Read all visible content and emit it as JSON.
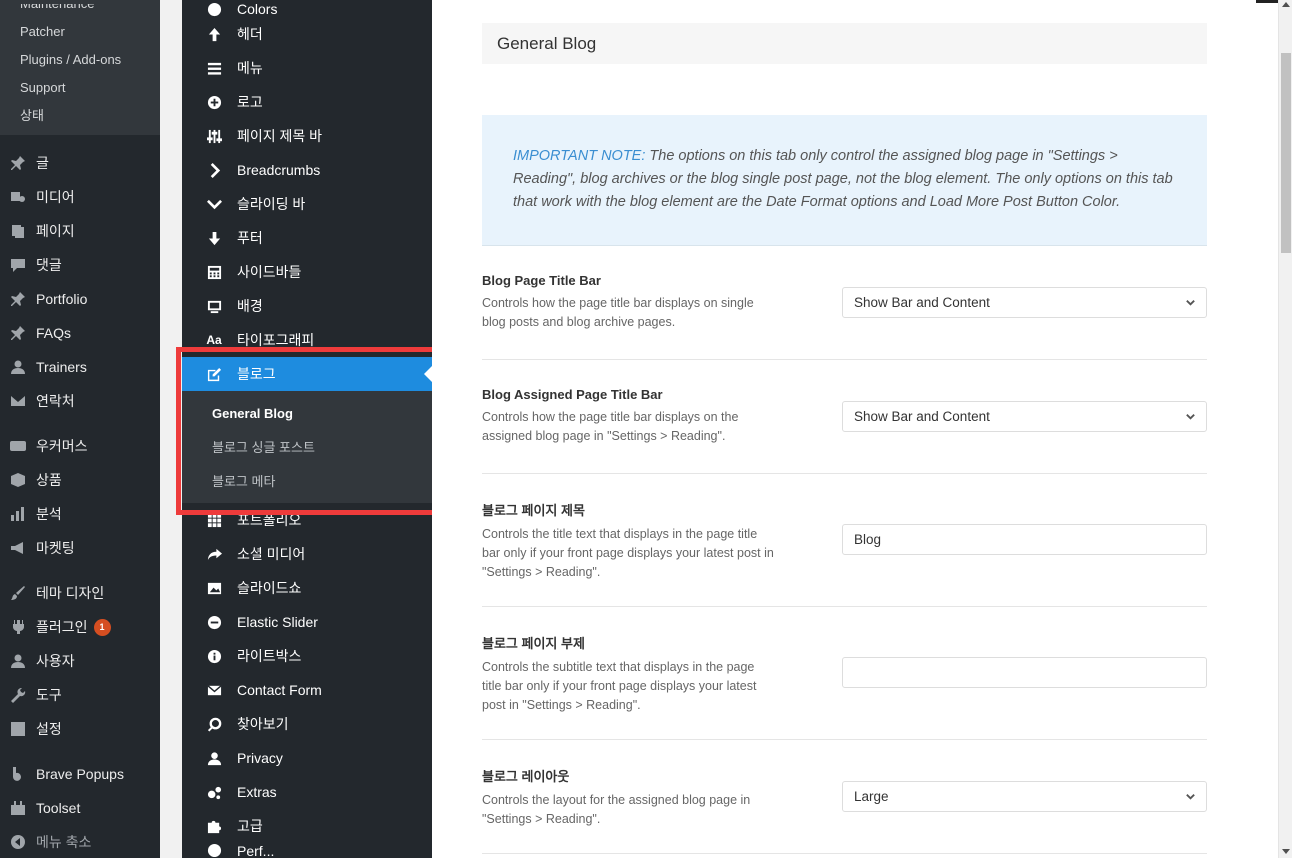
{
  "wp_menu": {
    "top_cut": "Maintenance",
    "submenu": [
      "Patcher",
      "Plugins / Add-ons",
      "Support",
      "상태"
    ],
    "items": [
      {
        "label": "글",
        "icon": "pin-icon"
      },
      {
        "label": "미디어",
        "icon": "media-icon"
      },
      {
        "label": "페이지",
        "icon": "page-icon"
      },
      {
        "label": "댓글",
        "icon": "comment-icon"
      },
      {
        "label": "Portfolio",
        "icon": "pin-icon"
      },
      {
        "label": "FAQs",
        "icon": "pin-icon"
      },
      {
        "label": "Trainers",
        "icon": "user-icon"
      },
      {
        "label": "연락처",
        "icon": "mail-icon"
      }
    ],
    "items2": [
      {
        "label": "우커머스",
        "icon": "woo-icon"
      },
      {
        "label": "상품",
        "icon": "box-icon"
      },
      {
        "label": "분석",
        "icon": "chart-icon"
      },
      {
        "label": "마켓팅",
        "icon": "megaphone-icon"
      }
    ],
    "items3": [
      {
        "label": "테마 디자인",
        "icon": "brush-icon"
      },
      {
        "label": "플러그인",
        "icon": "plugin-icon",
        "badge": "1"
      },
      {
        "label": "사용자",
        "icon": "user-icon"
      },
      {
        "label": "도구",
        "icon": "wrench-icon"
      },
      {
        "label": "설정",
        "icon": "settings-icon"
      }
    ],
    "items4": [
      {
        "label": "Brave Popups",
        "icon": "brave-icon"
      },
      {
        "label": "Toolset",
        "icon": "toolset-icon"
      },
      {
        "label": "메뉴 축소",
        "icon": "collapse-icon"
      }
    ]
  },
  "options_menu": {
    "top_cut": "Colors",
    "items_before": [
      {
        "label": "헤더",
        "icon": "arrow-up-icon"
      },
      {
        "label": "메뉴",
        "icon": "bars-icon"
      },
      {
        "label": "로고",
        "icon": "plus-circle-icon"
      },
      {
        "label": "페이지 제목 바",
        "icon": "sliders-icon"
      },
      {
        "label": "Breadcrumbs",
        "icon": "chevron-right-icon"
      },
      {
        "label": "슬라이딩 바",
        "icon": "chevron-down-icon"
      },
      {
        "label": "푸터",
        "icon": "arrow-down-icon"
      },
      {
        "label": "사이드바들",
        "icon": "calculator-icon"
      },
      {
        "label": "배경",
        "icon": "monitor-icon"
      },
      {
        "label": "타이포그래피",
        "icon": "typography-icon"
      }
    ],
    "active": {
      "label": "블로그",
      "icon": "edit-icon"
    },
    "sub": [
      "General Blog",
      "블로그 싱글 포스트",
      "블로그 메타"
    ],
    "items_after": [
      {
        "label": "포트폴리오",
        "icon": "grid-icon"
      },
      {
        "label": "소셜 미디어",
        "icon": "share-icon"
      },
      {
        "label": "슬라이드쇼",
        "icon": "image-icon"
      },
      {
        "label": "Elastic Slider",
        "icon": "minus-circle-icon"
      },
      {
        "label": "라이트박스",
        "icon": "info-icon"
      },
      {
        "label": "Contact Form",
        "icon": "envelope-icon"
      },
      {
        "label": "찾아보기",
        "icon": "search-icon"
      },
      {
        "label": "Privacy",
        "icon": "user-icon"
      },
      {
        "label": "Extras",
        "icon": "cogs-icon"
      },
      {
        "label": "고급",
        "icon": "puzzle-icon"
      }
    ],
    "bottom_cut": "Perf..."
  },
  "content": {
    "section_title": "General Blog",
    "note_label": "IMPORTANT NOTE:",
    "note_text": " The options on this tab only control the assigned blog page in \"Settings > Reading\", blog archives or the blog single post page, not the blog element. The only options on this tab that work with the blog element are the Date Format options and Load More Post Button Color.",
    "options": [
      {
        "label": "Blog Page Title Bar",
        "desc": "Controls how the page title bar displays on single blog posts and blog archive pages.",
        "value": "Show Bar and Content",
        "type": "select"
      },
      {
        "label": "Blog Assigned Page Title Bar",
        "desc": "Controls how the page title bar displays on the assigned blog page in \"Settings > Reading\".",
        "value": "Show Bar and Content",
        "type": "select"
      },
      {
        "label": "블로그 페이지 제목",
        "desc": "Controls the title text that displays in the page title bar only if your front page displays your latest post in \"Settings > Reading\".",
        "value": "Blog",
        "type": "text"
      },
      {
        "label": "블로그 페이지 부제",
        "desc": "Controls the subtitle text that displays in the page title bar only if your front page displays your latest post in \"Settings > Reading\".",
        "value": "",
        "type": "text"
      },
      {
        "label": "블로그 레이아웃",
        "desc": "Controls the layout for the assigned blog page in \"Settings > Reading\".",
        "value": "Large",
        "type": "select"
      }
    ]
  },
  "colors": {
    "accent": "#1e8cdf",
    "highlight": "#ee3b3b",
    "badge": "#d54e21"
  }
}
